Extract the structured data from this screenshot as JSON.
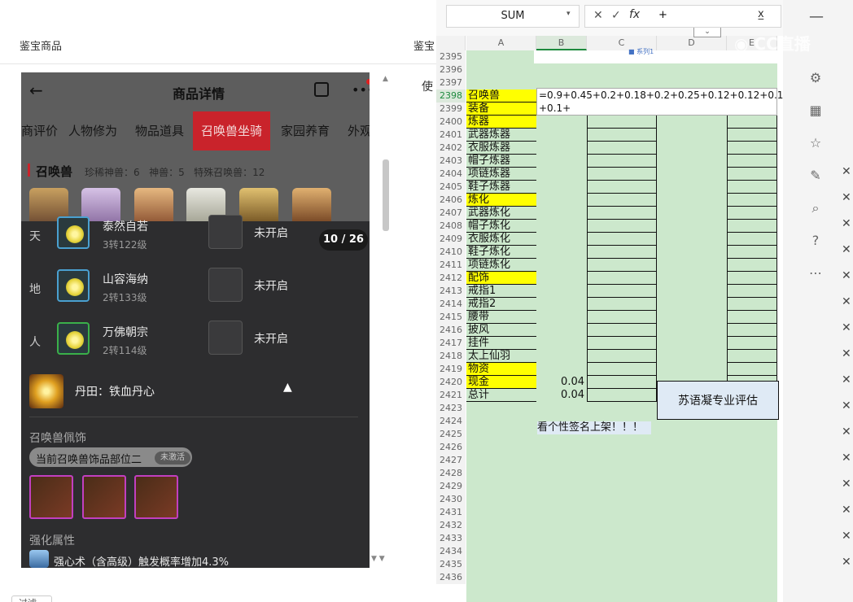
{
  "background_page": {
    "left_title": "鉴宝商品",
    "right_title_fragment": "鉴宝",
    "right_tab_fragment": "使",
    "bottom_button_fragment": "过滤"
  },
  "phone": {
    "header_title": "商品详情",
    "tabs": [
      "商评价",
      "人物修为",
      "物品道具",
      "召唤兽坐骑",
      "家园养育",
      "外观"
    ],
    "active_tab": "召唤兽坐骑",
    "section_title": "召唤兽",
    "section_stats": "珍稀神兽：6   神兽：5   特殊召唤兽：12",
    "page_counter": "10 / 26",
    "rows": [
      {
        "label": "天",
        "name": "泰然自若",
        "level": "3转122级",
        "status": "未开启"
      },
      {
        "label": "地",
        "name": "山容海纳",
        "level": "2转133级",
        "status": "未开启"
      },
      {
        "label": "人",
        "name": "万佛朝宗",
        "level": "2转114级",
        "status": "未开启"
      }
    ],
    "dantian": "丹田：铁血丹心",
    "accessory_title": "召唤兽佩饰",
    "accessory_part": "当前召唤兽饰品部位二",
    "accessory_badge": "未激活",
    "enhance_title": "强化属性",
    "enhance_line": "强心术（含高级）触发概率增加4.3%"
  },
  "excel": {
    "name_box": "SUM",
    "formula_input": "+",
    "col_headers": [
      "A",
      "B",
      "C",
      "D",
      "E"
    ],
    "formula_line1": "=0.9+0.45+0.2+0.18+0.2+0.25+0.12+0.12+0.1",
    "formula_line2": "+0.1+",
    "chart_legend": "系列1",
    "rows": [
      {
        "n": "2395",
        "a": ""
      },
      {
        "n": "2396",
        "a": ""
      },
      {
        "n": "2397",
        "a": ""
      },
      {
        "n": "2398",
        "a": "召唤兽",
        "y": true
      },
      {
        "n": "2399",
        "a": "装备",
        "y": true
      },
      {
        "n": "2400",
        "a": "炼器",
        "y": true
      },
      {
        "n": "2401",
        "a": "武器炼器"
      },
      {
        "n": "2402",
        "a": "衣服炼器"
      },
      {
        "n": "2403",
        "a": "帽子炼器"
      },
      {
        "n": "2404",
        "a": "项链炼器"
      },
      {
        "n": "2405",
        "a": "鞋子炼器"
      },
      {
        "n": "2406",
        "a": "炼化",
        "y": true
      },
      {
        "n": "2407",
        "a": "武器炼化"
      },
      {
        "n": "2408",
        "a": "帽子炼化"
      },
      {
        "n": "2409",
        "a": "衣服炼化"
      },
      {
        "n": "2410",
        "a": "鞋子炼化"
      },
      {
        "n": "2411",
        "a": "项链炼化"
      },
      {
        "n": "2412",
        "a": "配饰",
        "y": true
      },
      {
        "n": "2413",
        "a": "戒指1"
      },
      {
        "n": "2414",
        "a": "戒指2"
      },
      {
        "n": "2415",
        "a": "腰带"
      },
      {
        "n": "2416",
        "a": "披风"
      },
      {
        "n": "2417",
        "a": "挂件"
      },
      {
        "n": "2418",
        "a": "太上仙羽"
      },
      {
        "n": "2419",
        "a": "物资",
        "y": true
      },
      {
        "n": "2420",
        "a": "现金",
        "y": true,
        "b": "0.04"
      },
      {
        "n": "2421",
        "a": "总计",
        "b": "0.04"
      },
      {
        "n": "2423",
        "a": ""
      },
      {
        "n": "2424",
        "a": ""
      },
      {
        "n": "2425",
        "a": ""
      },
      {
        "n": "2426",
        "a": ""
      },
      {
        "n": "2427",
        "a": ""
      },
      {
        "n": "2428",
        "a": ""
      },
      {
        "n": "2429",
        "a": ""
      },
      {
        "n": "2430",
        "a": ""
      },
      {
        "n": "2431",
        "a": ""
      },
      {
        "n": "2432",
        "a": ""
      },
      {
        "n": "2433",
        "a": ""
      },
      {
        "n": "2434",
        "a": ""
      },
      {
        "n": "2435",
        "a": ""
      },
      {
        "n": "2436",
        "a": ""
      }
    ],
    "d_note": "苏语凝专业评估",
    "b_note": "看个性签名上架！！！"
  },
  "overlay": {
    "watermark": "CC直播"
  },
  "colors": {
    "excel_green": "#cce8cc",
    "highlight_yellow": "#ffff00",
    "active_tab_red": "#c9232b",
    "popup_bg": "#2d2d2f"
  }
}
